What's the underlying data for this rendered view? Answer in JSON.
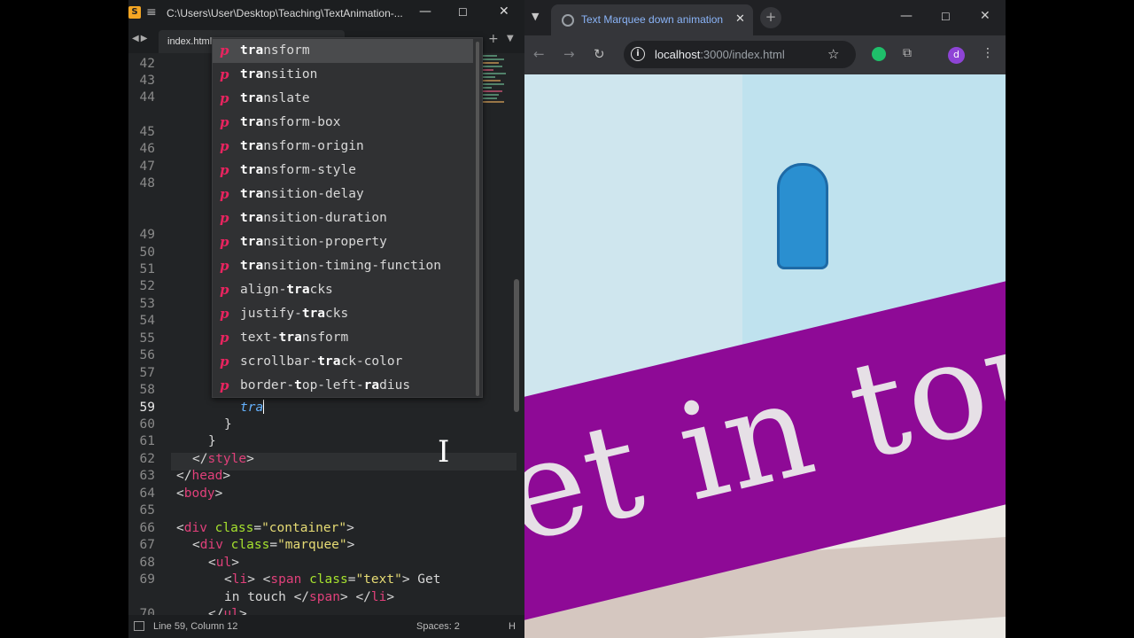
{
  "editor": {
    "title_path": "C:\\Users\\User\\Desktop\\Teaching\\TextAnimation-...",
    "file_tab": "index.html",
    "status_position": "Line 59, Column 12",
    "status_indent": "Spaces: 2",
    "status_lang": "H",
    "line_numbers": [
      "42",
      "43",
      "44",
      "45",
      "46",
      "47",
      "48",
      "49",
      "50",
      "51",
      "52",
      "53",
      "54",
      "55",
      "56",
      "57",
      "58",
      "59",
      "60",
      "61",
      "62",
      "63",
      "64",
      "65",
      "66",
      "67",
      "68",
      "69",
      "70"
    ],
    "current_line": "59",
    "typed_text": "tra",
    "line_60": "}",
    "line_61": "}",
    "line_62": [
      "</",
      "style",
      ">"
    ],
    "line_63": [
      "</",
      "head",
      ">"
    ],
    "line_64": [
      "<",
      "body",
      ">"
    ],
    "line_66": [
      "<",
      "div",
      " ",
      "class",
      "=",
      "\"container\"",
      ">"
    ],
    "line_67": [
      "<",
      "div",
      " ",
      "class",
      "=",
      "\"marquee\"",
      ">"
    ],
    "line_68": [
      "<",
      "ul",
      ">"
    ],
    "line_69": [
      "<",
      "li",
      "> ",
      "<",
      "span",
      " ",
      "class",
      "=",
      "\"text\"",
      "> Get"
    ],
    "line_69b": [
      "in touch ",
      "</",
      "span",
      "> ",
      "</",
      "li",
      ">"
    ],
    "line_70": [
      "</",
      "ul",
      ">"
    ]
  },
  "autocomplete": {
    "kind_glyph": "p",
    "items": [
      {
        "match": "tra",
        "rest": "nsform"
      },
      {
        "match": "tra",
        "rest": "nsition"
      },
      {
        "match": "tra",
        "rest": "nslate"
      },
      {
        "match": "tra",
        "rest": "nsform-box"
      },
      {
        "match": "tra",
        "rest": "nsform-origin"
      },
      {
        "match": "tra",
        "rest": "nsform-style"
      },
      {
        "match": "tra",
        "rest": "nsition-delay"
      },
      {
        "match": "tra",
        "rest": "nsition-duration"
      },
      {
        "match": "tra",
        "rest": "nsition-property"
      },
      {
        "match": "tra",
        "rest": "nsition-timing-function"
      }
    ],
    "items_mixed": [
      {
        "pre": "align-",
        "b1": "tra",
        "post": "cks"
      },
      {
        "pre": "justify-",
        "b1": "tra",
        "post": "cks"
      },
      {
        "pre": "text-",
        "b1": "tra",
        "post": "nsform"
      },
      {
        "pre": "scrollbar-",
        "b1": "tra",
        "post": "ck-color"
      }
    ],
    "last_item": {
      "b1": "",
      "t1": "border-",
      "b2": "t",
      "t2": "op-left-",
      "b3": "ra",
      "t3": "dius"
    }
  },
  "browser": {
    "tab_title": "Text Marquee down animation",
    "url_host": "localhost",
    "url_rest": ":3000/index.html",
    "avatar_letter": "d",
    "marquee_text": "et in tou"
  },
  "colors": {
    "marquee_band": "#8e0a96",
    "tag": "#e0407a",
    "attribute": "#a6e22e",
    "string": "#e6db74"
  }
}
